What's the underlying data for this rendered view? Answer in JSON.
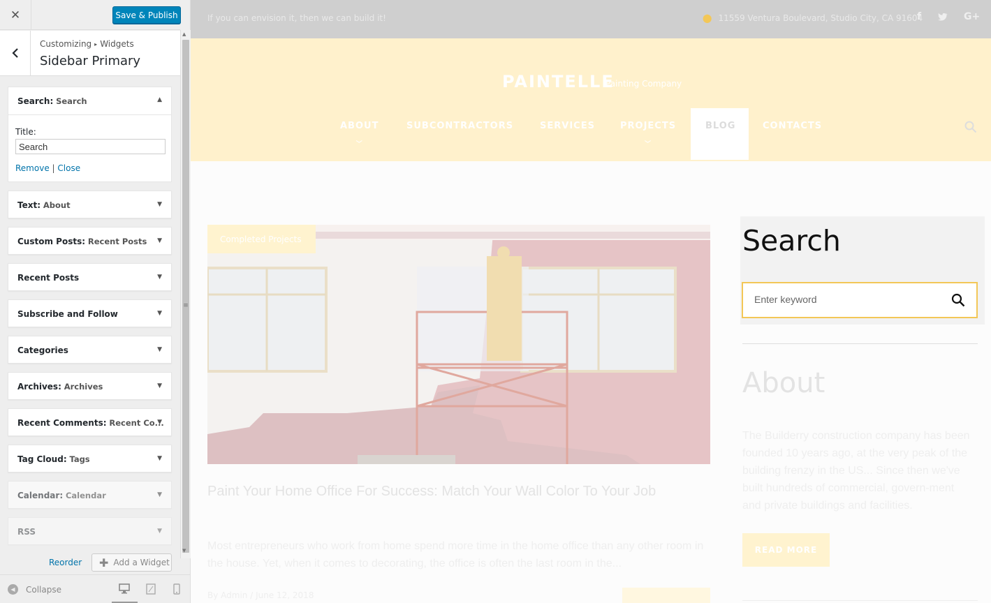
{
  "customizer": {
    "publish_label": "Save & Publish",
    "breadcrumb": {
      "root": "Customizing",
      "separator": "▸",
      "current": "Widgets"
    },
    "section_title": "Sidebar Primary",
    "expanded_widget": {
      "type": "Search",
      "name": "Search",
      "title_label": "Title:",
      "title_value": "Search",
      "remove_label": "Remove",
      "divider": "|",
      "close_label": "Close"
    },
    "widgets": [
      {
        "type": "Text",
        "name": "About"
      },
      {
        "type": "Custom Posts",
        "name": "Recent Posts"
      },
      {
        "type": "Recent Posts",
        "name": ""
      },
      {
        "type": "Subscribe and Follow",
        "name": ""
      },
      {
        "type": "Categories",
        "name": ""
      },
      {
        "type": "Archives",
        "name": "Archives"
      },
      {
        "type": "Recent Comments",
        "name": "Recent Co..."
      },
      {
        "type": "Tag Cloud",
        "name": "Tags"
      },
      {
        "type": "Calendar",
        "name": "Calendar"
      },
      {
        "type": "RSS",
        "name": ""
      }
    ],
    "reorder_label": "Reorder",
    "add_widget_label": "Add a Widget",
    "collapse_label": "Collapse"
  },
  "preview": {
    "tagline": "If you can envision it, then we can build it!",
    "address": "11559 Ventura Boulevard, Studio City, CA 91604",
    "logo": "PAINTELLE",
    "logo_tagline": "Painting Company",
    "nav": [
      "ABOUT",
      "SUBCONTRACTORS",
      "SERVICES",
      "PROJECTS",
      "BLOG",
      "CONTACTS"
    ],
    "active_nav": "BLOG",
    "post": {
      "category": "Completed Projects",
      "title": "Paint Your Home Office For Success: Match Your Wall Color To Your Job",
      "excerpt": "Most entrepreneurs who work from home spend more time in the home office than any other room in the house. Yet, when it comes to decorating, the office is often the last room in the...",
      "meta": "By Admin   /   June 12, 2018"
    },
    "sidebar": {
      "search_title": "Search",
      "search_placeholder": "Enter keyword",
      "about_title": "About",
      "about_text": "The Builderry construction company has been founded 10 years ago, at the very peak of the building frenzy in the US... Since then we've built hundreds of commercial, govern-ment and private buildings and facilities.",
      "about_button": "READ MORE"
    },
    "colors": {
      "accent": "#f3c757",
      "header_bg": "#fff1cc",
      "topbar_bg": "#cfcfcf",
      "wp_blue": "#0085ba"
    }
  }
}
